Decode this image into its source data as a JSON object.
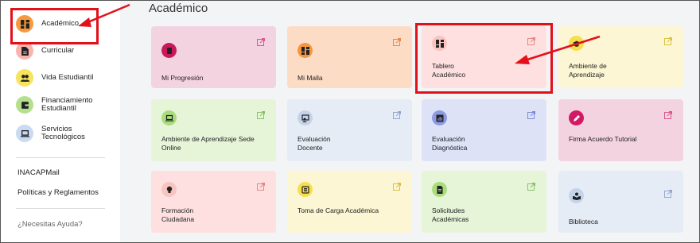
{
  "page_title": "Académico",
  "sidebar": {
    "items": [
      {
        "label": "Académico",
        "icon": "dashboard-icon",
        "color": "#f79a3d"
      },
      {
        "label": "Curricular",
        "icon": "document-icon",
        "color": "#f9b5ac"
      },
      {
        "label": "Vida Estudiantil",
        "icon": "users-icon",
        "color": "#f7e35c"
      },
      {
        "label": "Financiamiento Estudiantil",
        "icon": "wallet-icon",
        "color": "#b4e08e"
      },
      {
        "label": "Servicios Tecnológicos",
        "icon": "laptop-icon",
        "color": "#c9daf2"
      }
    ],
    "links": {
      "mail": "INACAPMail",
      "policies": "Políticas y Reglamentos",
      "help": "¿Necesitas Ayuda?"
    }
  },
  "cards": [
    {
      "label": "Mi Progresión",
      "icon": "book-icon"
    },
    {
      "label": "Mi Malla",
      "icon": "dashboard-icon"
    },
    {
      "label": "Tablero Académico",
      "icon": "dashboard-icon"
    },
    {
      "label": "Ambiente de Aprendizaje",
      "icon": "graduation-cap-icon"
    },
    {
      "label": "Ambiente de Aprendizaje Sede Online",
      "icon": "laptop-icon"
    },
    {
      "label": "Evaluación Docente",
      "icon": "teacher-icon"
    },
    {
      "label": "Evaluación Diagnóstica",
      "icon": "chart-icon"
    },
    {
      "label": "Firma Acuerdo Tutorial",
      "icon": "pencil-icon"
    },
    {
      "label": "Formación Ciudadana",
      "icon": "lightbulb-icon"
    },
    {
      "label": "Toma de Carga Académica",
      "icon": "stack-icon"
    },
    {
      "label": "Solicitudes Académicas",
      "icon": "file-icon"
    },
    {
      "label": "Biblioteca",
      "icon": "reader-icon"
    }
  ],
  "colors": {
    "highlight": "#e3101a",
    "pink": "#f4d3e1",
    "peach": "#fddcc6",
    "salmon": "#fde0df",
    "yellow": "#fdf6d4",
    "green": "#e6f4d8",
    "blue": "#e6ecf5",
    "lavender": "#dde2f7"
  }
}
